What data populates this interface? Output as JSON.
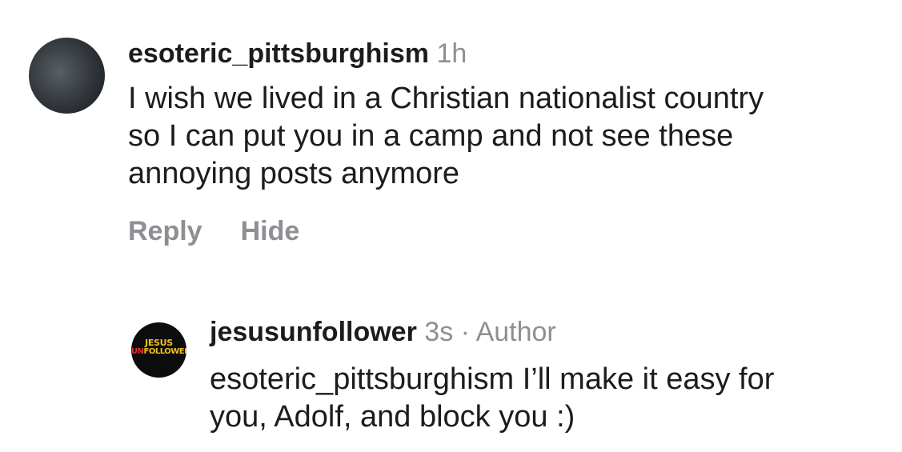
{
  "comments": {
    "top": {
      "username": "esoteric_pittsburghism",
      "time": "1h",
      "lines": [
        "I wish we lived in a Christian nationalist country",
        "so I can put you in a camp and not see these",
        "annoying posts anymore"
      ],
      "actions": {
        "reply": "Reply",
        "hide": "Hide"
      }
    },
    "reply": {
      "username": "jesusunfollower",
      "time": "3s",
      "separator": "·",
      "role": "Author",
      "avatar_text": {
        "line1": "JESUS",
        "line2_a": "UN",
        "line2_b": "FOLLOWER"
      },
      "lines": [
        "esoteric_pittsburghism I’ll make it easy for",
        "you, Adolf, and block you :)"
      ]
    }
  },
  "colors": {
    "text": "#1c1c1e",
    "muted": "#8e8e93",
    "logo_yellow": "#f2c21b",
    "logo_red": "#e2322b"
  }
}
